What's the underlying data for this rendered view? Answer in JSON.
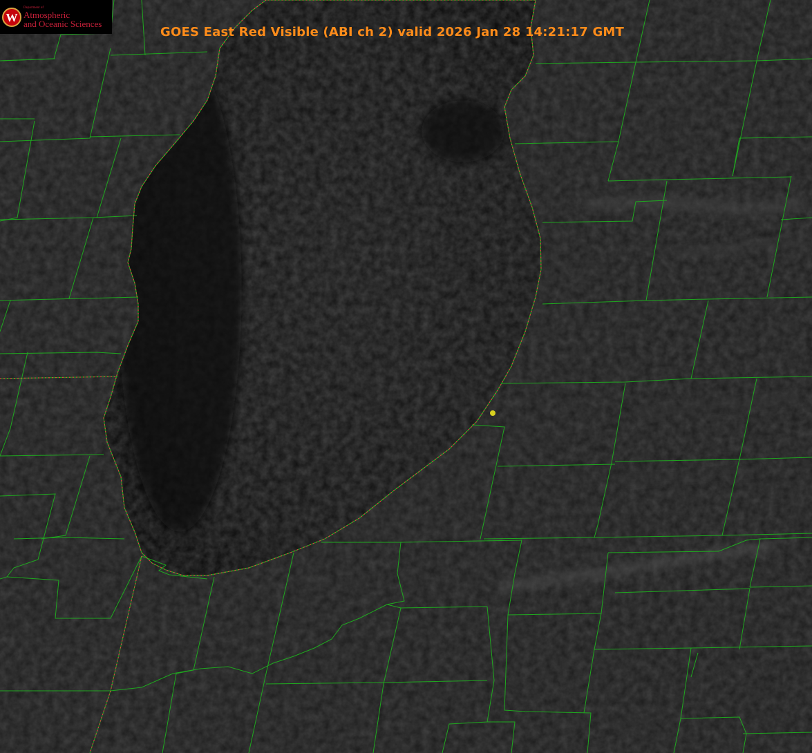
{
  "header": {
    "title": "GOES East Red Visible (ABI ch 2) valid 2026 Jan 28 14:21:17 GMT"
  },
  "logo": {
    "department_line": "Department of",
    "line1": "Atmospheric",
    "line2": "and Oceanic Sciences",
    "emblem_letter": "W"
  },
  "colors": {
    "title": "#ff8c1a",
    "county_lines": "#1fa81f",
    "state_border": "#e04040",
    "marker": "#d8d020",
    "lake": "#0e0e0e",
    "land": "#1c1c1c",
    "logo_text": "#c8203a"
  },
  "icons": {
    "emblem": "uw-crest-icon",
    "marker": "point-marker-icon"
  }
}
